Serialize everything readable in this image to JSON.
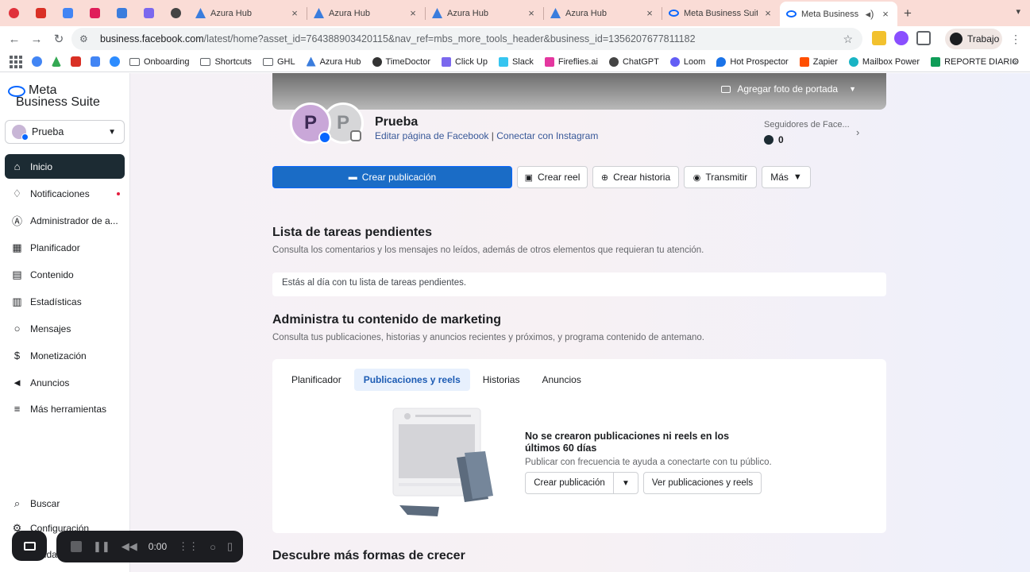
{
  "browser": {
    "pinned_tabs": [
      {
        "icon": "record-icon",
        "color": "#e0323c"
      },
      {
        "icon": "gmail-icon",
        "color": "#d93025"
      },
      {
        "icon": "calendar-icon",
        "color": "#4285f4"
      },
      {
        "icon": "slack-icon",
        "color": "#e01e5a"
      },
      {
        "icon": "azura-icon",
        "color": "#3b7ddd"
      },
      {
        "icon": "clickup-icon",
        "color": "#7b68ee"
      },
      {
        "icon": "chatgpt-icon",
        "color": "#444444"
      }
    ],
    "tabs": [
      {
        "title": "Azura Hub",
        "icon": "azura-icon",
        "active": false
      },
      {
        "title": "Azura Hub",
        "icon": "azura-icon",
        "active": false
      },
      {
        "title": "Azura Hub",
        "icon": "azura-icon",
        "active": false
      },
      {
        "title": "Azura Hub",
        "icon": "azura-icon",
        "active": false
      },
      {
        "title": "Meta Business Suite",
        "icon": "meta-icon",
        "active": false
      },
      {
        "title": "Meta Business Su",
        "icon": "meta-icon",
        "active": true
      }
    ],
    "close_glyph": "×",
    "new_tab_glyph": "+",
    "url_host": "business.facebook.com",
    "url_path": "/latest/home?asset_id=764388903420115&nav_ref=mbs_more_tools_header&business_id=1356207677811182",
    "profile_label": "Trabajo",
    "bookmarks": [
      {
        "label": "Onboarding",
        "icon": "folder-icon"
      },
      {
        "label": "Shortcuts",
        "icon": "folder-icon"
      },
      {
        "label": "GHL",
        "icon": "folder-icon"
      },
      {
        "label": "Azura Hub",
        "icon": "azura-icon"
      },
      {
        "label": "TimeDoctor",
        "icon": "timedoctor-icon"
      },
      {
        "label": "Click Up",
        "icon": "clickup-icon"
      },
      {
        "label": "Slack",
        "icon": "slack-icon"
      },
      {
        "label": "Fireflies.ai",
        "icon": "fireflies-icon"
      },
      {
        "label": "ChatGPT",
        "icon": "chatgpt-icon"
      },
      {
        "label": "Loom",
        "icon": "loom-icon"
      },
      {
        "label": "Hot Prospector",
        "icon": "hotprospector-icon"
      },
      {
        "label": "Zapier",
        "icon": "zapier-icon"
      },
      {
        "label": "Mailbox Power",
        "icon": "mailbox-icon"
      },
      {
        "label": "REPORTE DIARIO",
        "icon": "sheets-icon"
      }
    ]
  },
  "sidebar": {
    "logo_line1": "Meta",
    "logo_line2": "Business Suite",
    "account_name": "Prueba",
    "items": [
      {
        "label": "Inicio",
        "icon": "home-icon",
        "active": true
      },
      {
        "label": "Notificaciones",
        "icon": "bell-icon",
        "active": false
      },
      {
        "label": "Administrador de a...",
        "icon": "admin-icon",
        "active": false
      },
      {
        "label": "Planificador",
        "icon": "calendar-icon",
        "active": false
      },
      {
        "label": "Contenido",
        "icon": "content-icon",
        "active": false
      },
      {
        "label": "Estadísticas",
        "icon": "stats-icon",
        "active": false
      },
      {
        "label": "Mensajes",
        "icon": "message-icon",
        "active": false
      },
      {
        "label": "Monetización",
        "icon": "money-icon",
        "active": false
      },
      {
        "label": "Anuncios",
        "icon": "megaphone-icon",
        "active": false
      },
      {
        "label": "Más herramientas",
        "icon": "menu-icon",
        "active": false
      }
    ],
    "bottom": [
      {
        "label": "Buscar",
        "icon": "search-icon"
      },
      {
        "label": "Configuración",
        "icon": "gear-icon"
      },
      {
        "label": "Ayuda",
        "icon": "help-icon"
      }
    ]
  },
  "profile": {
    "cover_button": "Agregar foto de portada",
    "avatar_letter": "P",
    "name": "Prueba",
    "link_facebook": "Editar página de Facebook",
    "link_sep": "|",
    "link_instagram": "Conectar con Instagram",
    "followers_label": "Seguidores de Face...",
    "followers_count": "0"
  },
  "actions": {
    "create_post": "Crear publicación",
    "create_reel": "Crear reel",
    "create_story": "Crear historia",
    "stream": "Transmitir",
    "more": "Más"
  },
  "todo": {
    "title": "Lista de tareas pendientes",
    "subtitle": "Consulta los comentarios y los mensajes no leídos, además de otros elementos que requieran tu atención.",
    "status": "Estás al día con tu lista de tareas pendientes."
  },
  "marketing": {
    "title": "Administra tu contenido de marketing",
    "subtitle": "Consulta tus publicaciones, historias y anuncios recientes y próximos, y programa contenido de antemano.",
    "tabs": [
      {
        "label": "Planificador",
        "active": false
      },
      {
        "label": "Publicaciones y reels",
        "active": true
      },
      {
        "label": "Historias",
        "active": false
      },
      {
        "label": "Anuncios",
        "active": false
      }
    ],
    "empty_title": "No se crearon publicaciones ni reels en los últimos 60 días",
    "empty_subtitle": "Publicar con frecuencia te ayuda a conectarte con tu público.",
    "create_button": "Crear publicación",
    "view_button": "Ver publicaciones y reels"
  },
  "grow": {
    "title": "Descubre más formas de crecer"
  },
  "recorder": {
    "time": "0:00"
  },
  "colors": {
    "primary": "#1a6cc6",
    "nav_active": "#1c2b33",
    "tab_strip": "#fadcd6"
  }
}
